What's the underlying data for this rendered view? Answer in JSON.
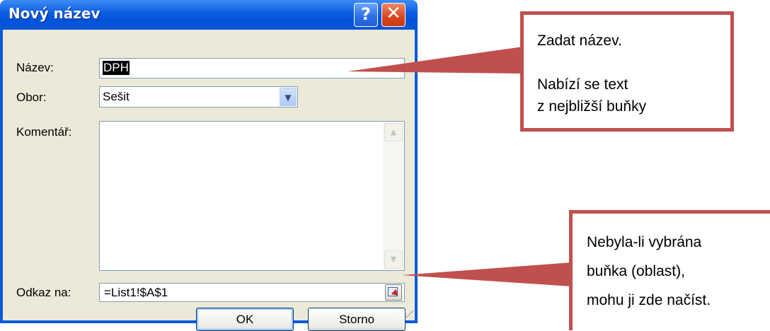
{
  "dialog": {
    "title": "Nový název",
    "help_glyph": "?",
    "close_glyph": "✕",
    "fields": {
      "name_label": "Název:",
      "name_value": "DPH",
      "scope_label": "Obor:",
      "scope_value": "Sešit",
      "comment_label": "Komentář:",
      "comment_value": "",
      "ref_label": "Odkaz na:",
      "ref_value": "=List1!$A$1"
    },
    "buttons": {
      "ok": "OK",
      "cancel": "Storno"
    }
  },
  "callouts": {
    "top": {
      "line1": "Zadat název.",
      "line2": "Nabízí se text",
      "line3": "z nejbližší buňky"
    },
    "bottom": {
      "line1": "Nebyla-li vybrána",
      "line2": "buňka (oblast),",
      "line3": "mohu ji zde načíst."
    }
  },
  "colors": {
    "titlebar": "#0a5ce0",
    "dialog_bg": "#ece9d8",
    "callout_border": "#c0504d"
  },
  "icons": {
    "help": "help-icon",
    "close": "close-icon",
    "dropdown": "chevron-down-icon",
    "range_picker": "range-select-icon"
  }
}
